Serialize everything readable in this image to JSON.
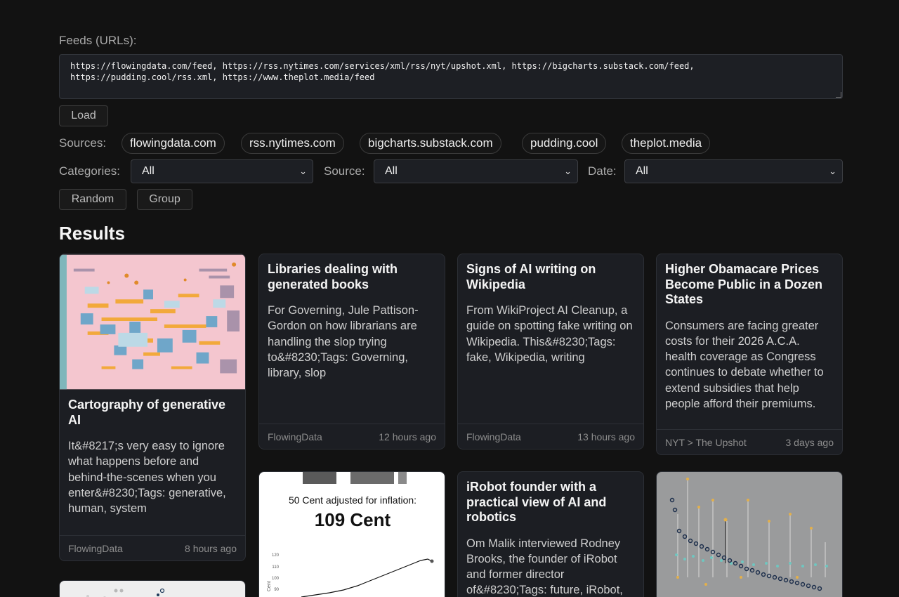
{
  "feeds": {
    "label": "Feeds (URLs):",
    "value": "https://flowingdata.com/feed, https://rss.nytimes.com/services/xml/rss/nyt/upshot.xml, https://bigcharts.substack.com/feed,\nhttps://pudding.cool/rss.xml, https://www.theplot.media/feed",
    "load_label": "Load"
  },
  "sources": {
    "label": "Sources:",
    "chips": [
      "flowingdata.com",
      "rss.nytimes.com",
      "bigcharts.substack.com",
      "pudding.cool",
      "theplot.media"
    ]
  },
  "filters": {
    "categories_label": "Categories:",
    "categories_value": "All",
    "source_label": "Source:",
    "source_value": "All",
    "date_label": "Date:",
    "date_value": "All"
  },
  "actions": {
    "random_label": "Random",
    "group_label": "Group"
  },
  "results": {
    "title": "Results",
    "cards": [
      {
        "title": "Cartography of generative AI",
        "description": "It&#8217;s very easy to ignore what happens before and behind-the-scenes when you enter&#8230;Tags: generative, human, system",
        "source": "FlowingData",
        "time": "8 hours ago"
      },
      {
        "title": "Libraries dealing with generated books",
        "description": "For Governing, Jule Pattison-Gordon on how librarians are handling the slop trying to&#8230;Tags: Governing, library, slop",
        "source": "FlowingData",
        "time": "12 hours ago"
      },
      {
        "title": "Signs of AI writing on Wikipedia",
        "description": "From WikiProject AI Cleanup, a guide on spotting fake writing on Wikipedia. This&#8230;Tags: fake, Wikipedia, writing",
        "source": "FlowingData",
        "time": "13 hours ago"
      },
      {
        "title": "Higher Obamacare Prices Become Public in a Dozen States",
        "description": "Consumers are facing greater costs for their 2026 A.C.A. health coverage as Congress continues to debate whether to extend subsidies that help people afford their premiums.",
        "source": "NYT > The Upshot",
        "time": "3 days ago"
      },
      {
        "thumb_caption": "50 Cent adjusted for inflation:",
        "thumb_value": "109 Cent",
        "thumb_axis": "Cent",
        "thumb_ticks": [
          "120",
          "110",
          "100",
          "90"
        ]
      },
      {
        "title": "iRobot founder with a practical view of AI and robotics",
        "description": "Om Malik interviewed Rodney Brooks, the founder of iRobot and former director of&#8230;Tags: future, iRobot,"
      }
    ]
  },
  "colors": {
    "background": "#121212",
    "card": "#1c1e23",
    "border": "#2c2f35",
    "thumb_pink": "#f4c6cf",
    "thumb_gray": "#9a9b9c"
  }
}
